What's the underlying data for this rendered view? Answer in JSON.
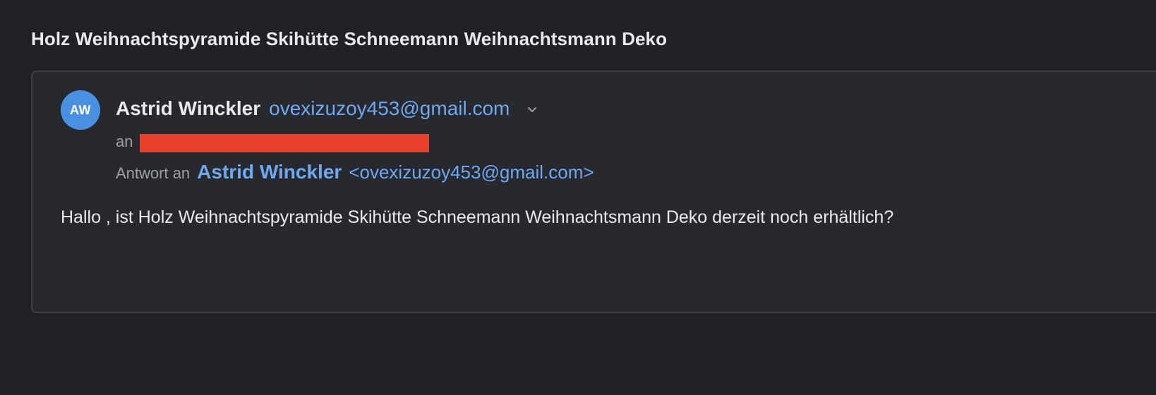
{
  "email": {
    "subject": "Holz Weihnachtspyramide Skihütte Schneemann Weihnachtsmann Deko",
    "sender": {
      "initials": "AW",
      "name": "Astrid Winckler",
      "email": "ovexizuzoy453@gmail.com"
    },
    "to_label": "an",
    "reply_to": {
      "label": "Antwort an",
      "name": "Astrid Winckler",
      "email": "<ovexizuzoy453@gmail.com>"
    },
    "body": "Hallo , ist Holz Weihnachtspyramide Skihütte Schneemann Weihnachtsmann Deko derzeit noch erhältlich?"
  },
  "colors": {
    "background": "#202124",
    "card": "#28292e",
    "accent": "#6ea8f0",
    "avatar": "#4a90e2",
    "redaction": "#e8402a"
  },
  "icons": {
    "expand": "chevron-down-icon"
  }
}
